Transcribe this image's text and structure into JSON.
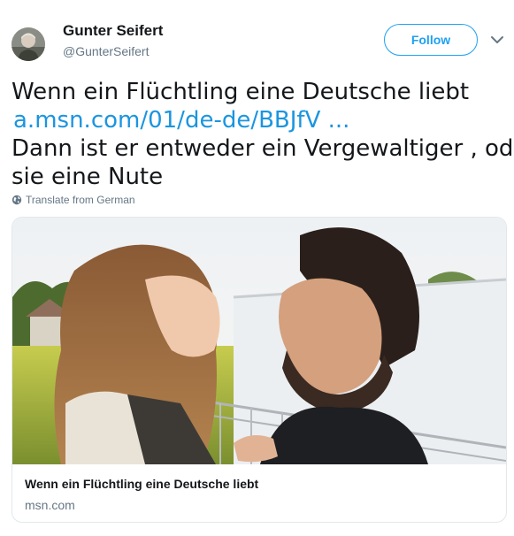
{
  "author": {
    "name": "Gunter Seifert",
    "handle": "@GunterSeifert",
    "avatar_icon": "user-avatar"
  },
  "actions": {
    "follow_label": "Follow",
    "more_icon": "chevron-down-icon"
  },
  "tweet": {
    "line1": "Wenn ein Flüchtling eine Deutsche liebt",
    "link": "a.msn.com/01/de-de/BBJfV ...",
    "line3": "Dann ist er entweder ein Vergewaltiger , oder",
    "line4": "sie eine Nute"
  },
  "translate": {
    "icon": "globe-icon",
    "label": "Translate from German"
  },
  "card": {
    "title": "Wenn ein Flüchtling eine Deutsche liebt",
    "domain": "msn.com"
  },
  "colors": {
    "accent": "#1da1f2",
    "link": "#1b95e0",
    "muted": "#657786",
    "text": "#14171a",
    "border": "#e1e8ed"
  }
}
